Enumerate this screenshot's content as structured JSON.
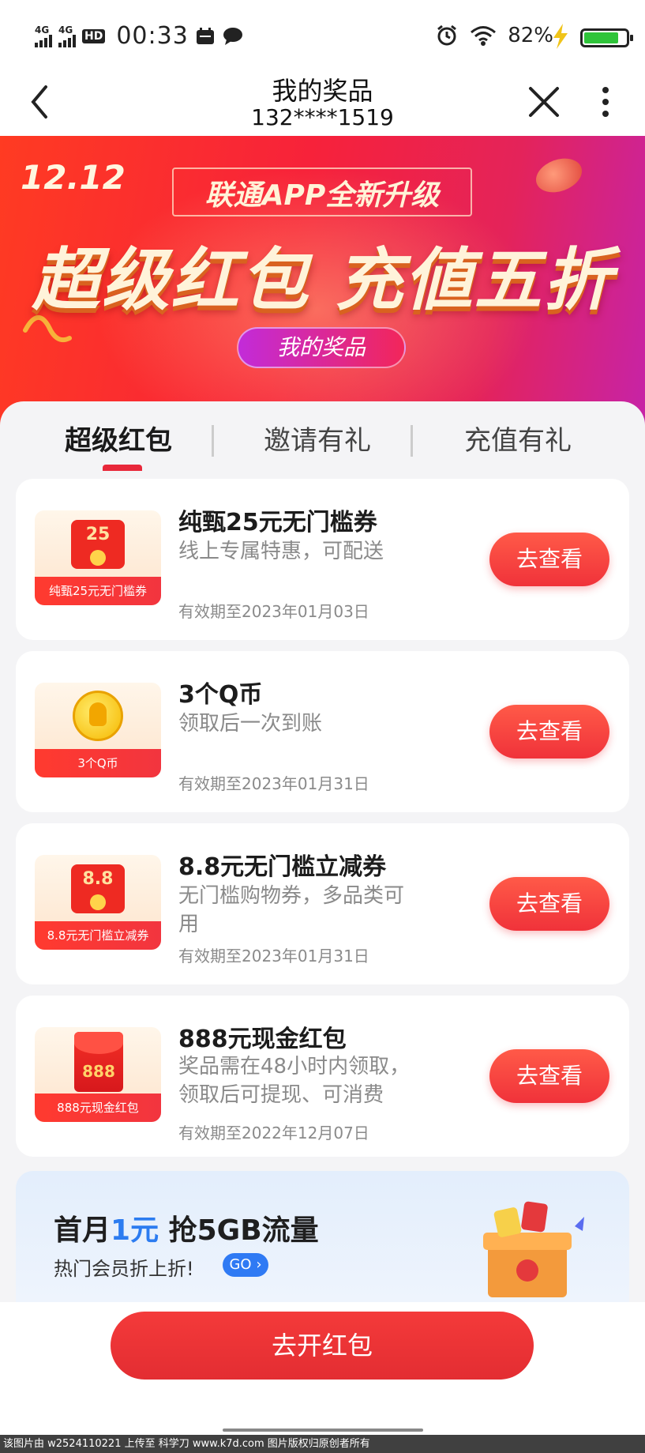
{
  "status_bar": {
    "signal_labels": [
      "4G",
      "4G"
    ],
    "hd_label": "HD",
    "time": "00:33",
    "battery_text": "82%",
    "battery_level": 0.82,
    "battery_color": "#2fc43a"
  },
  "nav": {
    "title": "我的奖品",
    "subtitle": "132****1519"
  },
  "banner": {
    "date_tag": "12.12",
    "top_text": "联通APP全新升级",
    "headline": "超级红包 充値五折",
    "pill_text": "我的奖品"
  },
  "tabs": [
    {
      "label": "超级红包",
      "active": true
    },
    {
      "label": "邀请有礼",
      "active": false
    },
    {
      "label": "充值有礼",
      "active": false
    }
  ],
  "prizes": [
    {
      "thumb_label": "纯甄25元无门槛券",
      "thumb_value": "25",
      "title": "纯甄25元无门槛券",
      "desc": "线上专属特惠，可配送",
      "expiry": "有效期至2023年01月03日",
      "button": "去查看"
    },
    {
      "thumb_label": "3个Q币",
      "thumb_value": "",
      "title": "3个Q币",
      "desc": "领取后一次到账",
      "expiry": "有效期至2023年01月31日",
      "button": "去查看"
    },
    {
      "thumb_label": "8.8元无门槛立减券",
      "thumb_value": "8.8",
      "title": "8.8元无门槛立减券",
      "desc": "无门槛购物券，多品类可用",
      "expiry": "有效期至2023年01月31日",
      "button": "去查看"
    },
    {
      "thumb_label": "888元现金红包",
      "thumb_value": "888",
      "title": "888元现金红包",
      "desc": "奖品需在48小时内领取，领取后可提现、可消费",
      "expiry": "有效期至2022年12月07日",
      "button": "去查看"
    }
  ],
  "promo": {
    "title_prefix": "首月",
    "title_highlight": "1元",
    "title_suffix": " 抢5GB流量",
    "subtitle": "热门会员折上折!",
    "go_label": "GO"
  },
  "bottom": {
    "button": "去开红包",
    "watermark": "该图片由 w2524110221 上传至 科学刀 www.k7d.com 图片版权归原创者所有"
  },
  "colors": {
    "accent": "#e8283a",
    "promo_highlight": "#2c7cf0"
  }
}
